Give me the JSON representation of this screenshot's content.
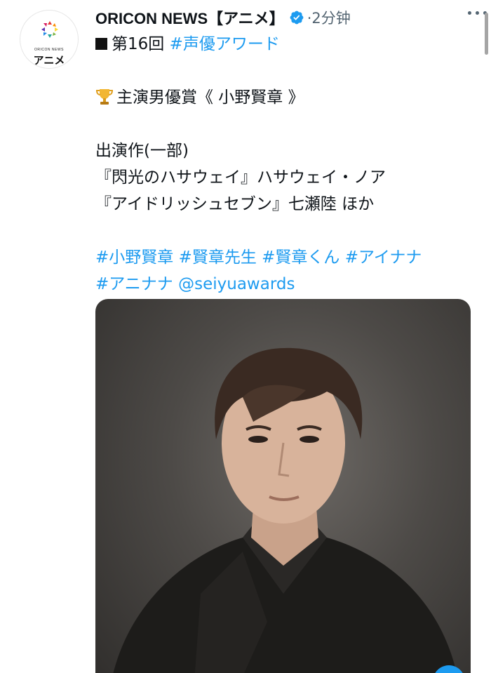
{
  "account": {
    "display_name": "ORICON NEWS【アニメ】",
    "time_text": "·2分钟",
    "avatar_subtitle": "ORICON NEWS",
    "avatar_title": "アニメ"
  },
  "tweet": {
    "line1": {
      "text": "第16回 ",
      "hashtag": "#声優アワード"
    },
    "award_line": "主演男優賞《 小野賢章 》",
    "works_title": "出演作(一部)",
    "work_1": "『閃光のハサウェイ』ハサウェイ・ノア",
    "work_2": "『アイドリッシュセブン』七瀬陸 ほか",
    "hashtag_line1": "#小野賢章 #賢章先生 #賢章くん #アイナナ",
    "hashtag_line2": "#アニナナ @seiyuawards"
  },
  "colors": {
    "link": "#1d9bf0",
    "text": "#0f1419",
    "secondary": "#536471"
  },
  "icons": [
    "verified-badge-icon",
    "more-options-icon",
    "trophy-icon"
  ]
}
